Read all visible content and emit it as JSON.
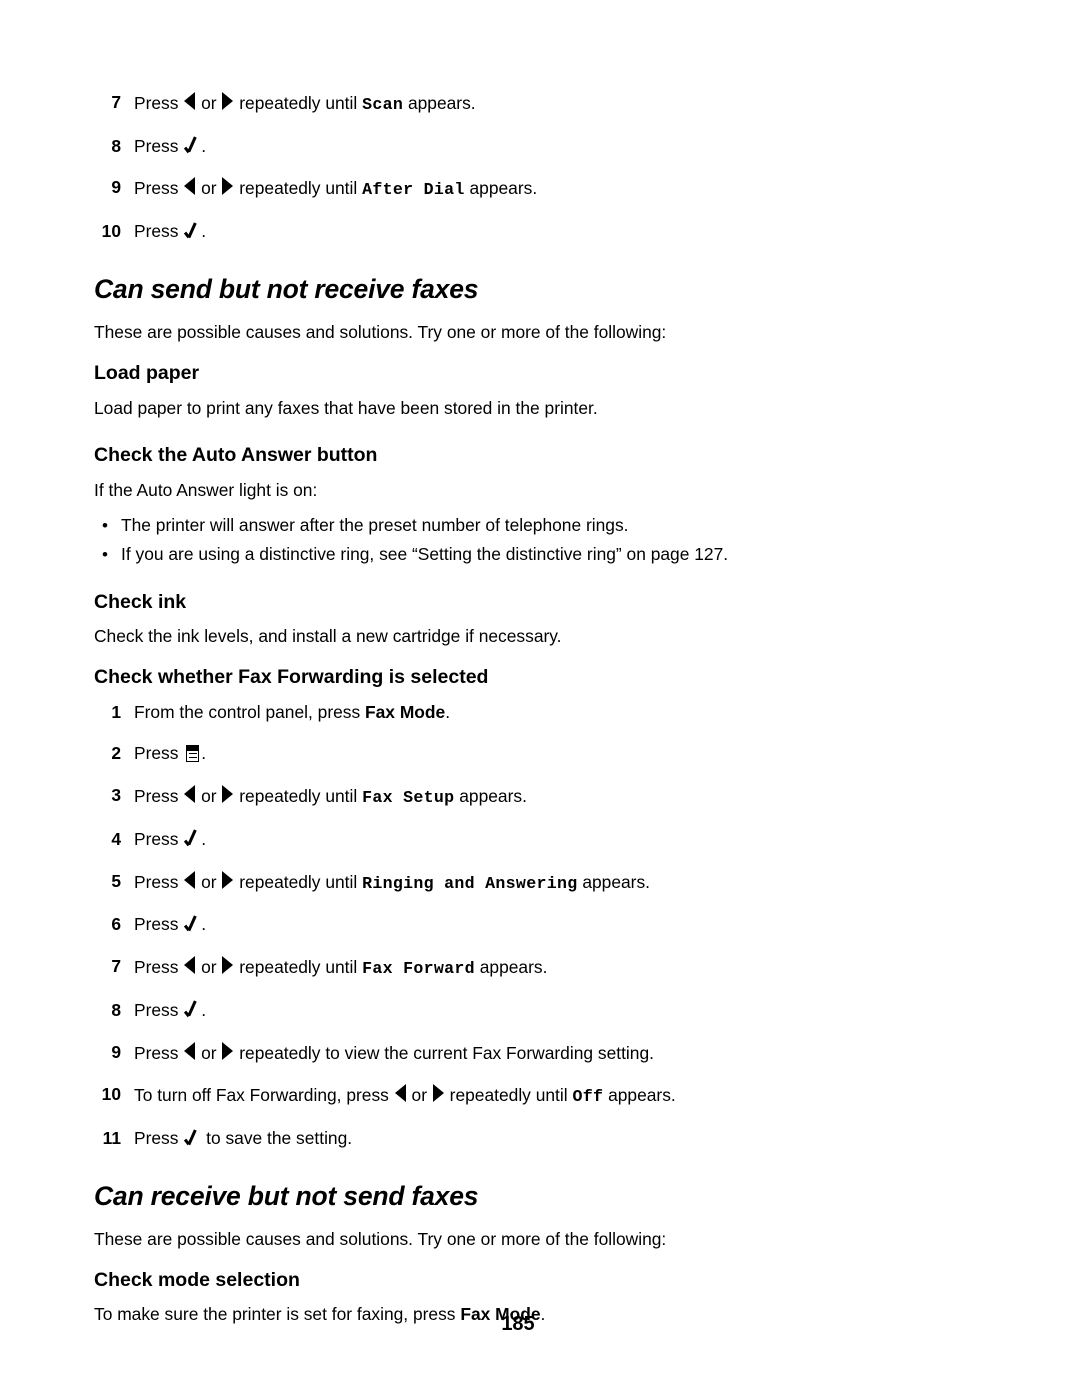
{
  "document": {
    "page_number": "185",
    "text_color": "#000000",
    "background_color": "#ffffff"
  },
  "top_steps": [
    {
      "num": "7",
      "parts": [
        {
          "t": "text",
          "v": "Press "
        },
        {
          "t": "icon",
          "v": "arrow-left-icon"
        },
        {
          "t": "text",
          "v": " or "
        },
        {
          "t": "icon",
          "v": "arrow-right-icon"
        },
        {
          "t": "text",
          "v": " repeatedly until "
        },
        {
          "t": "mono",
          "v": "Scan"
        },
        {
          "t": "text",
          "v": " appears."
        }
      ]
    },
    {
      "num": "8",
      "parts": [
        {
          "t": "text",
          "v": "Press "
        },
        {
          "t": "icon",
          "v": "checkmark-icon"
        },
        {
          "t": "text",
          "v": "."
        }
      ]
    },
    {
      "num": "9",
      "parts": [
        {
          "t": "text",
          "v": "Press "
        },
        {
          "t": "icon",
          "v": "arrow-left-icon"
        },
        {
          "t": "text",
          "v": " or "
        },
        {
          "t": "icon",
          "v": "arrow-right-icon"
        },
        {
          "t": "text",
          "v": " repeatedly until "
        },
        {
          "t": "mono",
          "v": "After Dial"
        },
        {
          "t": "text",
          "v": " appears."
        }
      ]
    },
    {
      "num": "10",
      "parts": [
        {
          "t": "text",
          "v": "Press "
        },
        {
          "t": "icon",
          "v": "checkmark-icon"
        },
        {
          "t": "text",
          "v": "."
        }
      ]
    }
  ],
  "section_send": {
    "title": "Can send but not receive faxes",
    "intro": "These are possible causes and solutions. Try one or more of the following:",
    "load_paper": {
      "heading": "Load paper",
      "body": "Load paper to print any faxes that have been stored in the printer."
    },
    "auto_answer": {
      "heading": "Check the Auto Answer button",
      "intro": "If the Auto Answer light is on:",
      "bullets": [
        "The printer will answer after the preset number of telephone rings.",
        "If you are using a distinctive ring, see “Setting the distinctive ring” on page 127."
      ]
    },
    "check_ink": {
      "heading": "Check ink",
      "body": "Check the ink levels, and install a new cartridge if necessary."
    },
    "fax_forwarding": {
      "heading": "Check whether Fax Forwarding is selected",
      "steps": [
        {
          "num": "1",
          "parts": [
            {
              "t": "text",
              "v": "From the control panel, press "
            },
            {
              "t": "bold",
              "v": "Fax Mode"
            },
            {
              "t": "text",
              "v": "."
            }
          ]
        },
        {
          "num": "2",
          "parts": [
            {
              "t": "text",
              "v": "Press "
            },
            {
              "t": "icon",
              "v": "menu-icon"
            },
            {
              "t": "text",
              "v": "."
            }
          ]
        },
        {
          "num": "3",
          "parts": [
            {
              "t": "text",
              "v": "Press "
            },
            {
              "t": "icon",
              "v": "arrow-left-icon"
            },
            {
              "t": "text",
              "v": " or "
            },
            {
              "t": "icon",
              "v": "arrow-right-icon"
            },
            {
              "t": "text",
              "v": " repeatedly until "
            },
            {
              "t": "mono",
              "v": "Fax Setup"
            },
            {
              "t": "text",
              "v": " appears."
            }
          ]
        },
        {
          "num": "4",
          "parts": [
            {
              "t": "text",
              "v": "Press "
            },
            {
              "t": "icon",
              "v": "checkmark-icon"
            },
            {
              "t": "text",
              "v": "."
            }
          ]
        },
        {
          "num": "5",
          "parts": [
            {
              "t": "text",
              "v": "Press "
            },
            {
              "t": "icon",
              "v": "arrow-left-icon"
            },
            {
              "t": "text",
              "v": " or "
            },
            {
              "t": "icon",
              "v": "arrow-right-icon"
            },
            {
              "t": "text",
              "v": " repeatedly until "
            },
            {
              "t": "mono",
              "v": "Ringing and Answering"
            },
            {
              "t": "text",
              "v": " appears."
            }
          ]
        },
        {
          "num": "6",
          "parts": [
            {
              "t": "text",
              "v": "Press "
            },
            {
              "t": "icon",
              "v": "checkmark-icon"
            },
            {
              "t": "text",
              "v": "."
            }
          ]
        },
        {
          "num": "7",
          "parts": [
            {
              "t": "text",
              "v": "Press "
            },
            {
              "t": "icon",
              "v": "arrow-left-icon"
            },
            {
              "t": "text",
              "v": " or "
            },
            {
              "t": "icon",
              "v": "arrow-right-icon"
            },
            {
              "t": "text",
              "v": " repeatedly until "
            },
            {
              "t": "mono",
              "v": "Fax Forward"
            },
            {
              "t": "text",
              "v": " appears."
            }
          ]
        },
        {
          "num": "8",
          "parts": [
            {
              "t": "text",
              "v": "Press "
            },
            {
              "t": "icon",
              "v": "checkmark-icon"
            },
            {
              "t": "text",
              "v": "."
            }
          ]
        },
        {
          "num": "9",
          "parts": [
            {
              "t": "text",
              "v": "Press "
            },
            {
              "t": "icon",
              "v": "arrow-left-icon"
            },
            {
              "t": "text",
              "v": " or "
            },
            {
              "t": "icon",
              "v": "arrow-right-icon"
            },
            {
              "t": "text",
              "v": " repeatedly to view the current Fax Forwarding setting."
            }
          ]
        },
        {
          "num": "10",
          "parts": [
            {
              "t": "text",
              "v": "To turn off Fax Forwarding, press "
            },
            {
              "t": "icon",
              "v": "arrow-left-icon"
            },
            {
              "t": "text",
              "v": " or "
            },
            {
              "t": "icon",
              "v": "arrow-right-icon"
            },
            {
              "t": "text",
              "v": " repeatedly until "
            },
            {
              "t": "mono",
              "v": "Off"
            },
            {
              "t": "text",
              "v": " appears."
            }
          ]
        },
        {
          "num": "11",
          "parts": [
            {
              "t": "text",
              "v": "Press "
            },
            {
              "t": "icon",
              "v": "checkmark-icon"
            },
            {
              "t": "text",
              "v": " to save the setting."
            }
          ]
        }
      ]
    }
  },
  "section_receive": {
    "title": "Can receive but not send faxes",
    "intro": "These are possible causes and solutions. Try one or more of the following:",
    "mode_selection": {
      "heading": "Check mode selection",
      "parts": [
        {
          "t": "text",
          "v": "To make sure the printer is set for faxing, press "
        },
        {
          "t": "bold",
          "v": "Fax Mode"
        },
        {
          "t": "text",
          "v": "."
        }
      ]
    }
  },
  "icons": {
    "arrow-left-icon": "◀",
    "arrow-right-icon": "▶",
    "checkmark-icon": "√",
    "menu-icon": "☰",
    "bullet-dot": "•"
  }
}
